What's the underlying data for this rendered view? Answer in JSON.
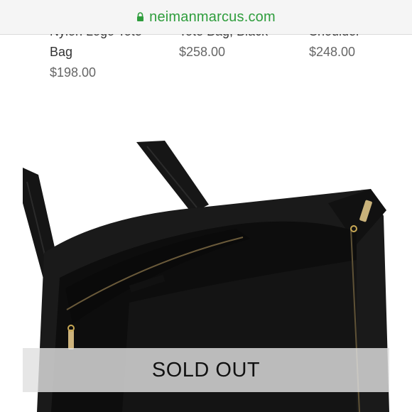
{
  "browser": {
    "url": "neimanmarcus.com",
    "accent": "#2e9d3c"
  },
  "products": [
    {
      "name_lines": [
        "Nylon Logo Tote",
        "Bag"
      ],
      "price": "$198.00"
    },
    {
      "name_lines": [
        "Tote Bag, Black"
      ],
      "price": "$258.00"
    },
    {
      "name_lines": [
        "Shoulder"
      ],
      "price": "$248.00"
    }
  ],
  "listing": {
    "image": "black-nylon-tote-bag-photo",
    "status": "SOLD OUT"
  },
  "icons": {
    "lock": "lock-icon"
  }
}
